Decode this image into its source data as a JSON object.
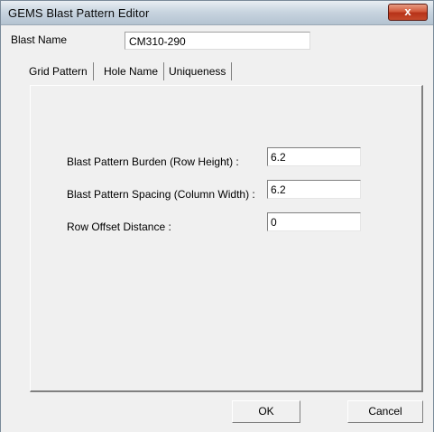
{
  "window": {
    "title": "GEMS Blast Pattern Editor",
    "close_glyph": "x"
  },
  "blast_name": {
    "label": "Blast Name",
    "value": "CM310-290"
  },
  "tabs": [
    {
      "label": "Grid Pattern",
      "active": true
    },
    {
      "label": "Hole Name",
      "active": false
    },
    {
      "label": "Uniqueness",
      "active": false
    }
  ],
  "grid_pattern": {
    "fields": [
      {
        "label": "Blast Pattern Burden (Row Height) :",
        "value": "6.2"
      },
      {
        "label": "Blast Pattern Spacing (Column Width) :",
        "value": "6.2"
      },
      {
        "label": "Row Offset Distance :",
        "value": "0"
      }
    ]
  },
  "buttons": {
    "ok": "OK",
    "cancel": "Cancel"
  },
  "colors": {
    "background": "#f0f0f0",
    "close_button": "#c44a2c",
    "title_bar": "#c9d5e0"
  }
}
